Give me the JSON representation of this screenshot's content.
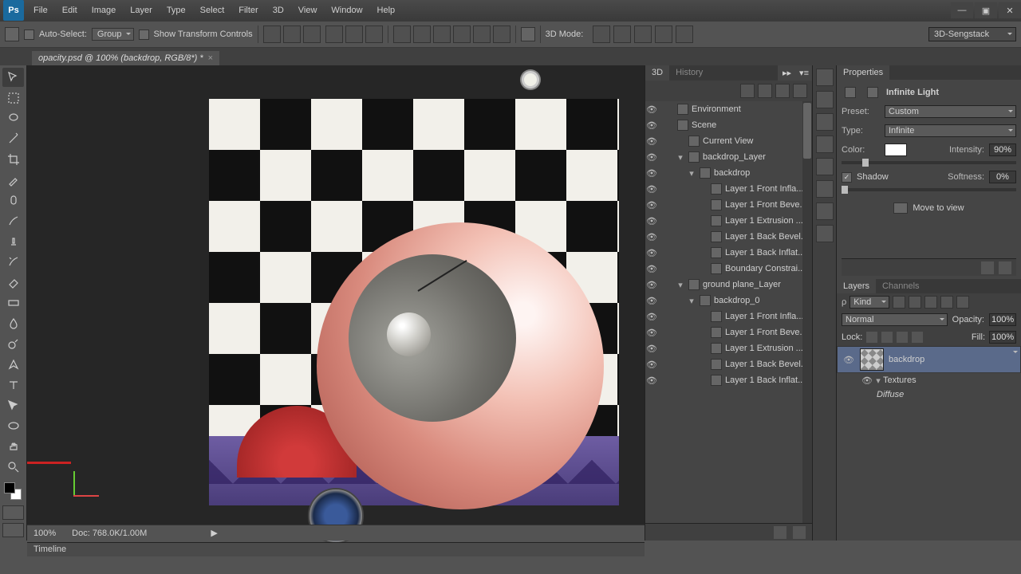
{
  "menu": {
    "file": "File",
    "edit": "Edit",
    "image": "Image",
    "layer": "Layer",
    "type": "Type",
    "select": "Select",
    "filter": "Filter",
    "threed": "3D",
    "view": "View",
    "window": "Window",
    "help": "Help"
  },
  "optbar": {
    "auto": "Auto-Select:",
    "group": "Group",
    "stc": "Show Transform Controls",
    "mode": "3D Mode:",
    "workspace": "3D-Sengstack"
  },
  "doctab": {
    "title": "opacity.psd @ 100% (backdrop, RGB/8*) *"
  },
  "statusbar": {
    "zoom": "100%",
    "doc": "Doc: 768.0K/1.00M"
  },
  "timeline": {
    "label": "Timeline"
  },
  "panel3d": {
    "tabs": {
      "a": "3D",
      "b": "History"
    },
    "rows": [
      {
        "ind": 0,
        "label": "Environment"
      },
      {
        "ind": 0,
        "label": "Scene"
      },
      {
        "ind": 1,
        "label": "Current View"
      },
      {
        "ind": 1,
        "label": "backdrop_Layer",
        "tw": "▾"
      },
      {
        "ind": 2,
        "label": "backdrop",
        "tw": "▾"
      },
      {
        "ind": 3,
        "label": "Layer 1 Front Infla..."
      },
      {
        "ind": 3,
        "label": "Layer 1 Front Beve..."
      },
      {
        "ind": 3,
        "label": "Layer 1 Extrusion ..."
      },
      {
        "ind": 3,
        "label": "Layer 1 Back Bevel..."
      },
      {
        "ind": 3,
        "label": "Layer 1 Back Inflat..."
      },
      {
        "ind": 3,
        "label": "Boundary Constrai..."
      },
      {
        "ind": 1,
        "label": "ground plane_Layer",
        "tw": "▾"
      },
      {
        "ind": 2,
        "label": "backdrop_0",
        "tw": "▾"
      },
      {
        "ind": 3,
        "label": "Layer 1 Front Infla..."
      },
      {
        "ind": 3,
        "label": "Layer 1 Front Beve..."
      },
      {
        "ind": 3,
        "label": "Layer 1 Extrusion ..."
      },
      {
        "ind": 3,
        "label": "Layer 1 Back Bevel..."
      },
      {
        "ind": 3,
        "label": "Layer 1 Back Inflat..."
      }
    ]
  },
  "props": {
    "title": "Properties",
    "heading": "Infinite Light",
    "preset_l": "Preset:",
    "preset_v": "Custom",
    "type_l": "Type:",
    "type_v": "Infinite",
    "color_l": "Color:",
    "color_v": "#ffffff",
    "intensity_l": "Intensity:",
    "intensity_v": "90%",
    "shadow_l": "Shadow",
    "soft_l": "Softness:",
    "soft_v": "0%",
    "mtv": "Move to view"
  },
  "layers": {
    "tabs": {
      "a": "Layers",
      "b": "Channels"
    },
    "kind": "Kind",
    "blend": "Normal",
    "opacity_l": "Opacity:",
    "opacity_v": "100%",
    "lock_l": "Lock:",
    "fill_l": "Fill:",
    "fill_v": "100%",
    "layer_name": "backdrop",
    "sub1": "Textures",
    "sub2": "Diffuse"
  }
}
